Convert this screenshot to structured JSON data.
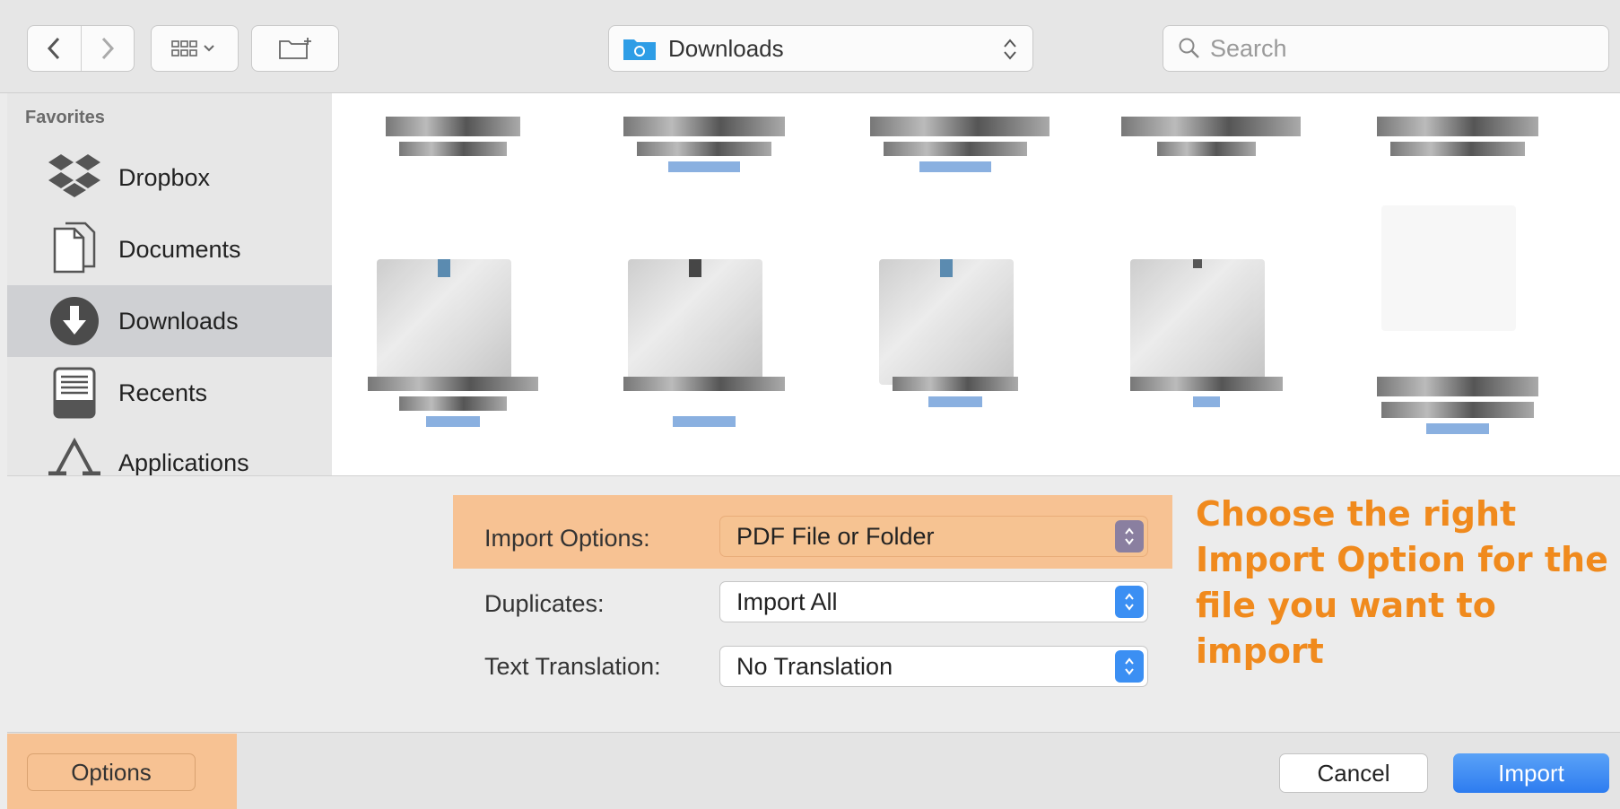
{
  "toolbar": {
    "back_icon": "chevron-left-icon",
    "forward_icon": "chevron-right-icon",
    "view_icon": "icon-grid-icon",
    "new_folder_icon": "new-folder-icon",
    "location": "Downloads",
    "search_placeholder": "Search"
  },
  "sidebar": {
    "heading": "Favorites",
    "items": [
      {
        "label": "Dropbox",
        "icon": "dropbox-icon"
      },
      {
        "label": "Documents",
        "icon": "documents-icon"
      },
      {
        "label": "Downloads",
        "icon": "downloads-icon",
        "selected": true
      },
      {
        "label": "Recents",
        "icon": "recents-icon"
      },
      {
        "label": "Applications",
        "icon": "applications-icon"
      }
    ]
  },
  "options": {
    "import_options": {
      "label": "Import Options:",
      "value": "PDF File or Folder"
    },
    "duplicates": {
      "label": "Duplicates:",
      "value": "Import All"
    },
    "text_translation": {
      "label": "Text Translation:",
      "value": "No Translation"
    }
  },
  "callout": "Choose the right Import Option for the file you want to import",
  "footer": {
    "options_label": "Options",
    "cancel_label": "Cancel",
    "import_label": "Import"
  },
  "colors": {
    "accent": "#2d7cf0",
    "highlight": "#f7c293",
    "callout_text": "#f08a1d"
  }
}
